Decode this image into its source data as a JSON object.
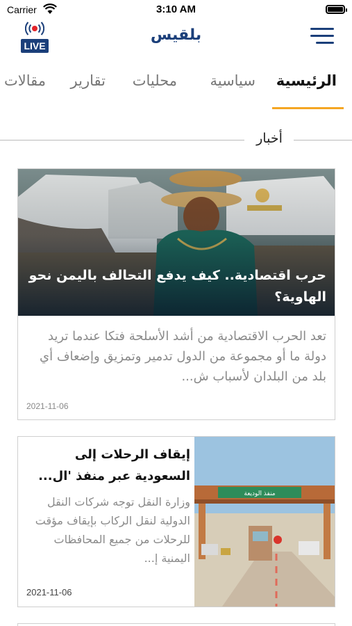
{
  "status_bar": {
    "carrier": "Carrier",
    "time": "3:10 AM"
  },
  "header": {
    "logo": "بلقيس",
    "live_label": "LIVE",
    "live_icon": "broadcast-icon",
    "menu_icon": "hamburger-menu-icon",
    "brand_color": "#1b3f7a",
    "accent_color": "#f5a623"
  },
  "tabs": [
    {
      "label": "الرئيسية",
      "active": true
    },
    {
      "label": "سياسية",
      "active": false
    },
    {
      "label": "محليات",
      "active": false
    },
    {
      "label": "تقارير",
      "active": false
    },
    {
      "label": "مقالات",
      "active": false
    }
  ],
  "section": {
    "title": "أخبار"
  },
  "articles": [
    {
      "title": "حرب اقتصادية.. كيف يدفع التحالف باليمن نحو الهاوية؟",
      "excerpt": "تعد الحرب الاقتصادية من أشد الأسلحة فتكا عندما تريد دولة ما أو مجموعة من الدول تدمير وتمزيق وإضعاف أي بلد من البلدان لأسباب ش...",
      "date": "2021-11-06"
    },
    {
      "title": "إيقاف الرحلات إلى السعودية عبر منفذ 'ال...",
      "excerpt": "وزارة النقل توجه شركات النقل الدولية لنقل الركاب بإيقاف مؤقت للرحلات من جميع المحافظات اليمنية إ...",
      "date": "2021-11-06",
      "image_sign_text": "منفذ الوديعة"
    }
  ]
}
